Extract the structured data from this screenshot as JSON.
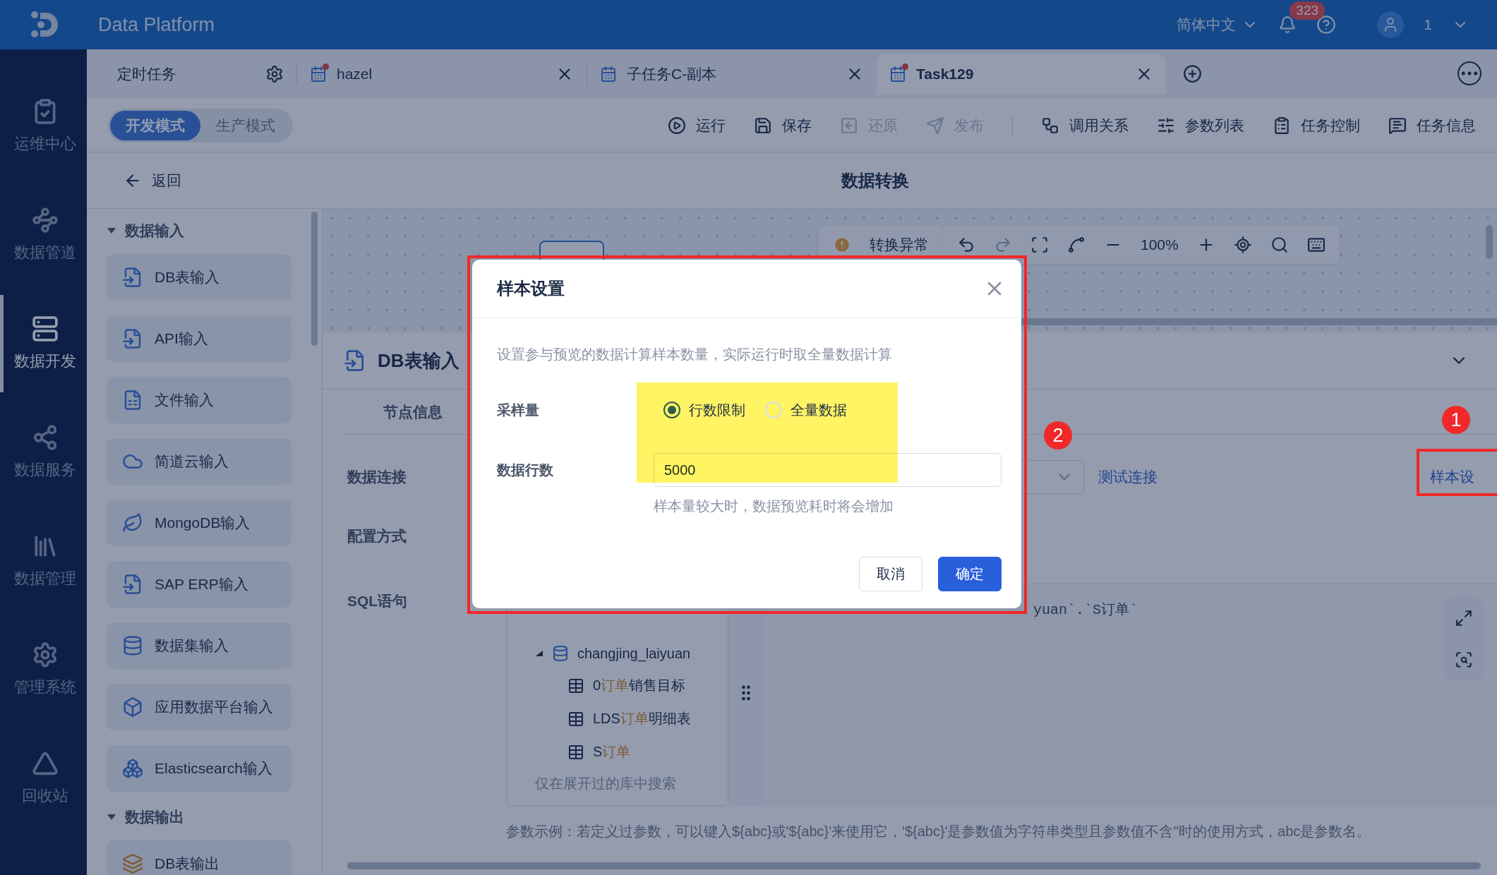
{
  "header": {
    "title": "Data Platform",
    "language": "简体中文",
    "notifications": "323",
    "user": "1"
  },
  "sidebar": {
    "items": [
      {
        "label": "运维中心",
        "selected": false
      },
      {
        "label": "数据管道",
        "selected": false
      },
      {
        "label": "数据开发",
        "selected": true
      },
      {
        "label": "数据服务",
        "selected": false
      },
      {
        "label": "数据管理",
        "selected": false
      },
      {
        "label": "管理系统",
        "selected": false
      },
      {
        "label": "回收站",
        "selected": false
      }
    ]
  },
  "tabs": [
    {
      "label": "定时任务",
      "kind": "fixed",
      "selected": false,
      "modified": false
    },
    {
      "label": "hazel",
      "kind": "task",
      "selected": false,
      "modified": true
    },
    {
      "label": "子任务C-副本",
      "kind": "task",
      "selected": false,
      "modified": false
    },
    {
      "label": "Task129",
      "kind": "task",
      "selected": true,
      "modified": true
    }
  ],
  "modes": [
    {
      "label": "开发模式",
      "selected": true
    },
    {
      "label": "生产模式",
      "selected": false
    }
  ],
  "action_groups": [
    [
      {
        "label": "运行",
        "disabled": false
      },
      {
        "label": "保存",
        "disabled": false
      },
      {
        "label": "还原",
        "disabled": true
      },
      {
        "label": "发布",
        "disabled": true
      }
    ],
    [
      {
        "label": "调用关系",
        "disabled": false
      },
      {
        "label": "参数列表",
        "disabled": false
      },
      {
        "label": "任务控制",
        "disabled": false
      },
      {
        "label": "任务信息",
        "disabled": false
      }
    ]
  ],
  "back": "返回",
  "page_title": "数据转换",
  "palette": {
    "sections": [
      {
        "title": "数据输入",
        "expanded": true,
        "items": [
          "DB表输入",
          "API输入",
          "文件输入",
          "简道云输入",
          "MongoDB输入",
          "SAP ERP输入",
          "数据集输入",
          "应用数据平台输入",
          "Elasticsearch输入"
        ]
      },
      {
        "title": "数据输出",
        "expanded": true,
        "items": [
          "DB表输出"
        ]
      }
    ]
  },
  "canvas": {
    "warning": "转换异常",
    "zoom": "100%"
  },
  "node": {
    "title": "DB表输入",
    "tabs": [
      {
        "label": "节点信息",
        "selected": true
      }
    ],
    "fields": [
      {
        "label": "数据连接",
        "kind": "connection"
      },
      {
        "label": "配置方式",
        "kind": "empty"
      },
      {
        "label": "SQL语句",
        "kind": "sql"
      }
    ],
    "test_link": "测试连接",
    "sample_link": "样本设",
    "tree": {
      "label": "changjing_laiyuan",
      "expanded": true,
      "children": [
        {
          "parts": [
            {
              "text": "0",
              "match": false
            },
            {
              "text": "订单",
              "match": true
            },
            {
              "text": "销售目标",
              "match": false
            }
          ]
        },
        {
          "parts": [
            {
              "text": "LDS",
              "match": false
            },
            {
              "text": "订单",
              "match": true
            },
            {
              "text": "明细表",
              "match": false
            }
          ]
        },
        {
          "parts": [
            {
              "text": "S",
              "match": false
            },
            {
              "text": "订单",
              "match": true
            }
          ]
        }
      ]
    },
    "tree_note": "仅在展开过的库中搜索",
    "sql": "yuan`.`S订单`",
    "hint": "参数示例：若定义过参数，可以键入${abc}或'${abc}'来使用它，'${abc}'是参数值为字符串类型且参数值不含''时的使用方式，abc是参数名。"
  },
  "dialog": {
    "title": "样本设置",
    "description": "设置参与预览的数据计算样本数量，实际运行时取全量数据计算",
    "fields": [
      {
        "label": "采样量",
        "kind": "radio",
        "options": [
          {
            "label": "行数限制",
            "selected": true
          },
          {
            "label": "全量数据",
            "selected": false
          }
        ]
      },
      {
        "label": "数据行数",
        "kind": "input",
        "value": "5000",
        "help": "样本量较大时，数据预览耗时将会增加"
      }
    ],
    "buttons": [
      {
        "label": "取消",
        "kind": "secondary"
      },
      {
        "label": "确定",
        "kind": "primary"
      }
    ]
  },
  "annotations": [
    {
      "label": "1"
    },
    {
      "label": "2"
    }
  ]
}
